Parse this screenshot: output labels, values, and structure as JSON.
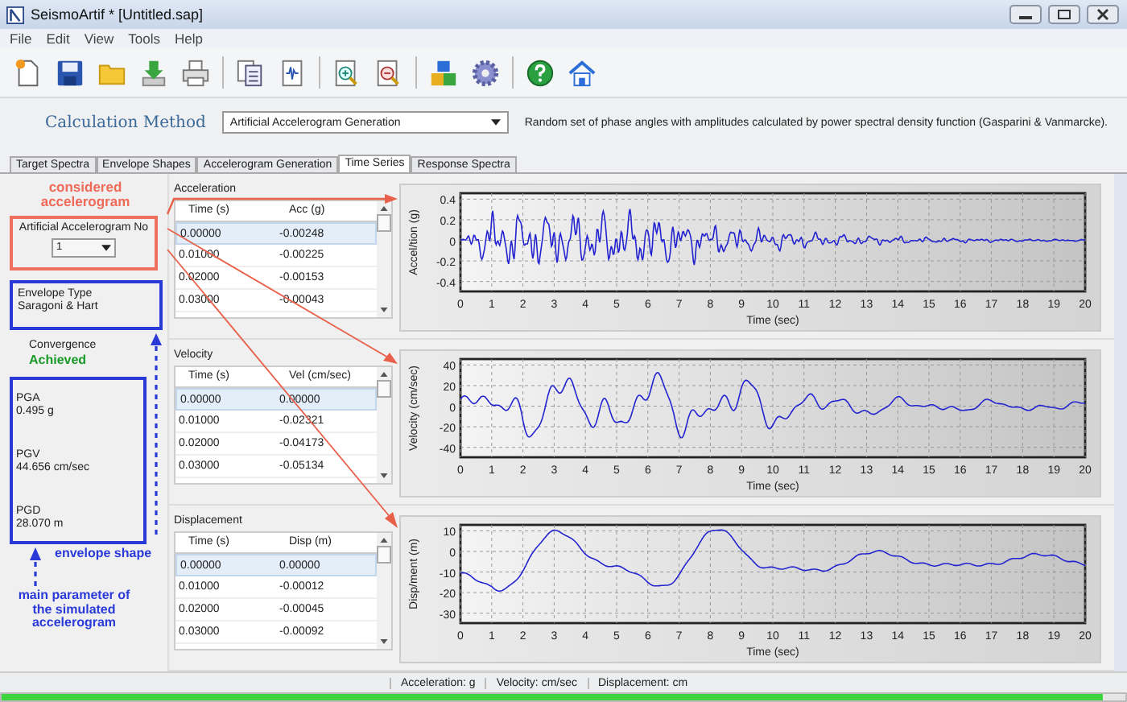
{
  "window": {
    "title": "SeismoArtif * [Untitled.sap]"
  },
  "menu": [
    "File",
    "Edit",
    "View",
    "Tools",
    "Help"
  ],
  "calculation_method": {
    "label": "Calculation Method",
    "value": "Artificial Accelerogram Generation",
    "description": "Random set of phase angles with amplitudes calculated by power spectral density function (Gasparini & Vanmarcke)."
  },
  "tabs": [
    {
      "label": "Target Spectra",
      "selected": false
    },
    {
      "label": "Envelope Shapes",
      "selected": false
    },
    {
      "label": "Accelerogram Generation",
      "selected": false
    },
    {
      "label": "Time Series",
      "selected": true
    },
    {
      "label": "Response Spectra",
      "selected": false
    }
  ],
  "left_panel": {
    "accelerogram_label": "Artificial Accelerogram No",
    "accelerogram_value": "1",
    "envelope_type_label": "Envelope Type",
    "envelope_type_value": "Saragoni & Hart",
    "convergence_label": "Convergence",
    "convergence_value": "Achieved",
    "parameters": [
      {
        "name": "PGA",
        "value": "0.495 g"
      },
      {
        "name": "PGV",
        "value": "44.656 cm/sec"
      },
      {
        "name": "PGD",
        "value": "28.070 m"
      }
    ]
  },
  "annotations": {
    "considered": "considered accelerogram",
    "envelope": "envelope shape",
    "main": "main parameter of the simulated accelerogram"
  },
  "sections": [
    {
      "title": "Acceleration",
      "columns": [
        "Time (s)",
        "Acc (g)"
      ],
      "rows": [
        {
          "cells": [
            "0.00000",
            "-0.00248"
          ],
          "selected": true
        },
        {
          "cells": [
            "0.01000",
            "-0.00225"
          ],
          "selected": false
        },
        {
          "cells": [
            "0.02000",
            "-0.00153"
          ],
          "selected": false
        },
        {
          "cells": [
            "0.03000",
            "-0.00043"
          ],
          "selected": false
        }
      ],
      "plot": {
        "ylabel": "Accel/tion (g)",
        "xlabel": "Time (sec)",
        "yticks": [
          "0.4",
          "0.2",
          "0",
          "-0.2",
          "-0.4"
        ],
        "xticks": [
          "0",
          "1",
          "2",
          "3",
          "4",
          "5",
          "6",
          "7",
          "8",
          "9",
          "10",
          "11",
          "12",
          "13",
          "14",
          "15",
          "16",
          "17",
          "18",
          "19",
          "20"
        ]
      }
    },
    {
      "title": "Velocity",
      "columns": [
        "Time (s)",
        "Vel (cm/sec)"
      ],
      "rows": [
        {
          "cells": [
            "0.00000",
            "0.00000"
          ],
          "selected": true
        },
        {
          "cells": [
            "0.01000",
            "-0.02321"
          ],
          "selected": false
        },
        {
          "cells": [
            "0.02000",
            "-0.04173"
          ],
          "selected": false
        },
        {
          "cells": [
            "0.03000",
            "-0.05134"
          ],
          "selected": false
        }
      ],
      "plot": {
        "ylabel": "Velocity (cm/sec)",
        "xlabel": "Time (sec)",
        "yticks": [
          "40",
          "20",
          "0",
          "-20",
          "-40"
        ],
        "xticks": [
          "0",
          "1",
          "2",
          "3",
          "4",
          "5",
          "6",
          "7",
          "8",
          "9",
          "10",
          "11",
          "12",
          "13",
          "14",
          "15",
          "16",
          "17",
          "18",
          "19",
          "20"
        ]
      }
    },
    {
      "title": "Displacement",
      "columns": [
        "Time (s)",
        "Disp (m)"
      ],
      "rows": [
        {
          "cells": [
            "0.00000",
            "0.00000"
          ],
          "selected": true
        },
        {
          "cells": [
            "0.01000",
            "-0.00012"
          ],
          "selected": false
        },
        {
          "cells": [
            "0.02000",
            "-0.00045"
          ],
          "selected": false
        },
        {
          "cells": [
            "0.03000",
            "-0.00092"
          ],
          "selected": false
        }
      ],
      "plot": {
        "ylabel": "Disp/ment (m)",
        "xlabel": "Time (sec)",
        "yticks": [
          "10",
          "0",
          "-10",
          "-20",
          "-30"
        ],
        "xticks": [
          "0",
          "1",
          "2",
          "3",
          "4",
          "5",
          "6",
          "7",
          "8",
          "9",
          "10",
          "11",
          "12",
          "13",
          "14",
          "15",
          "16",
          "17",
          "18",
          "19",
          "20"
        ]
      }
    }
  ],
  "status_bar": [
    "Acceleration: g",
    "Velocity: cm/sec",
    "Displacement: cm"
  ],
  "progress": {
    "level": 0.98
  }
}
